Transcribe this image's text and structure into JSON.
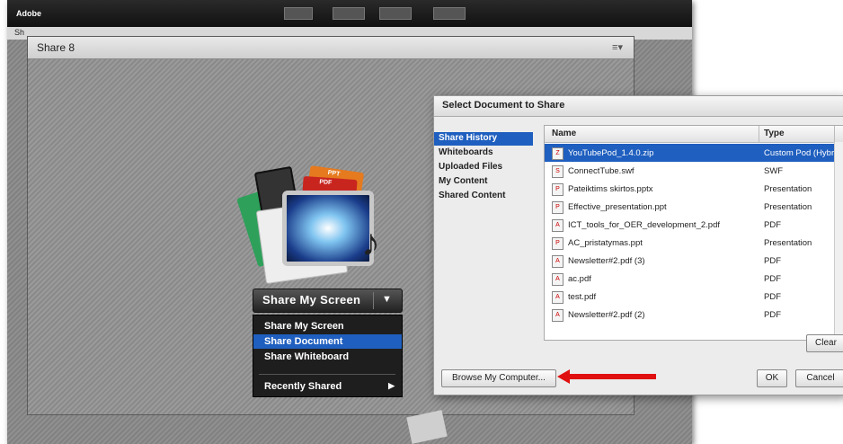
{
  "app": {
    "brand": "Adobe",
    "subbar_label": "Sh"
  },
  "pod": {
    "title": "Share 8",
    "menu_icon": "≡▾"
  },
  "share": {
    "button_label": "Share My Screen",
    "menu": [
      "Share My Screen",
      "Share Document",
      "Share Whiteboard"
    ],
    "recent": "Recently Shared",
    "selected_index": 1,
    "card_labels": [
      "PPT",
      "PDF"
    ]
  },
  "dialog": {
    "title": "Select Document to Share",
    "sidebar": [
      "Share History",
      "Whiteboards",
      "Uploaded Files",
      "My Content",
      "Shared Content"
    ],
    "columns": [
      "Name",
      "Type"
    ],
    "files": [
      {
        "name": "YouTubePod_1.4.0.zip",
        "type": "Custom Pod (Hybr",
        "icon": "zip-icon"
      },
      {
        "name": "ConnectTube.swf",
        "type": "SWF",
        "icon": "swf-icon"
      },
      {
        "name": "Pateiktims skirtos.pptx",
        "type": "Presentation",
        "icon": "ppt-icon"
      },
      {
        "name": "Effective_presentation.ppt",
        "type": "Presentation",
        "icon": "ppt-icon"
      },
      {
        "name": "ICT_tools_for_OER_development_2.pdf",
        "type": "PDF",
        "icon": "pdf-icon"
      },
      {
        "name": "AC_pristatymas.ppt",
        "type": "Presentation",
        "icon": "ppt-icon"
      },
      {
        "name": "Newsletter#2.pdf (3)",
        "type": "PDF",
        "icon": "pdf-icon"
      },
      {
        "name": "ac.pdf",
        "type": "PDF",
        "icon": "pdf-icon"
      },
      {
        "name": "test.pdf",
        "type": "PDF",
        "icon": "pdf-icon"
      },
      {
        "name": "Newsletter#2.pdf (2)",
        "type": "PDF",
        "icon": "pdf-icon"
      }
    ],
    "clear": "Clear",
    "browse": "Browse My Computer...",
    "ok": "OK",
    "cancel": "Cancel"
  },
  "colors": {
    "selection": "#1f5fbf",
    "arrow": "#e01010"
  }
}
